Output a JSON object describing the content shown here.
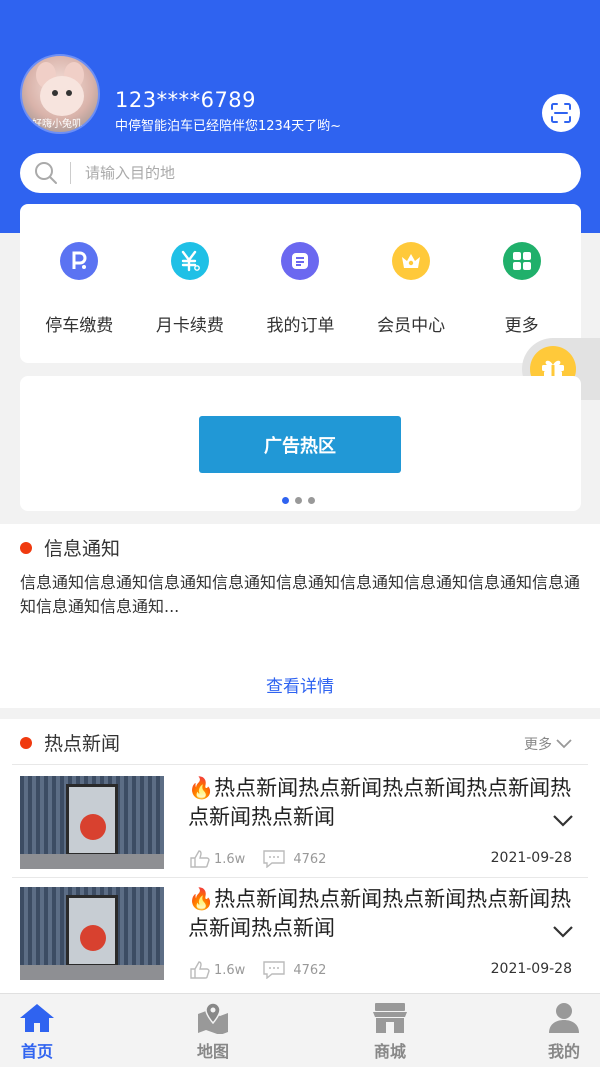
{
  "header": {
    "avatar_caption": "好嗨小兔叽",
    "phone": "123****6789",
    "subtitle": "中停智能泊车已经陪伴您1234天了哟~"
  },
  "search": {
    "placeholder": "请输入目的地"
  },
  "menu": [
    {
      "label": "停车缴费",
      "icon": "parking-icon",
      "color": "#5b73f2"
    },
    {
      "label": "月卡续费",
      "icon": "yuan-card-icon",
      "color": "#1fc0e6"
    },
    {
      "label": "我的订单",
      "icon": "order-icon",
      "color": "#6b68f0"
    },
    {
      "label": "会员中心",
      "icon": "crown-icon",
      "color": "#ffc93a"
    },
    {
      "label": "更多",
      "icon": "grid-icon",
      "color": "#20b06b"
    }
  ],
  "ad": {
    "label": "广告热区",
    "dots": 3,
    "active_dot": 1
  },
  "notice": {
    "title": "信息通知",
    "text": "信息通知信息通知信息通知信息通知信息通知信息通知信息通知信息通知信息通知信息通知信息通知...",
    "more": "查看详情"
  },
  "news": {
    "title": "热点新闻",
    "more": "更多",
    "items": [
      {
        "title": "热点新闻热点新闻热点新闻热点新闻热点新闻热点新闻",
        "likes": "1.6w",
        "comments": "4762",
        "date": "2021-09-28"
      },
      {
        "title": "热点新闻热点新闻热点新闻热点新闻热点新闻热点新闻",
        "likes": "1.6w",
        "comments": "4762",
        "date": "2021-09-28"
      }
    ]
  },
  "tabbar": [
    {
      "label": "首页",
      "icon": "home-icon",
      "active": true
    },
    {
      "label": "地图",
      "icon": "map-pin-icon",
      "active": false
    },
    {
      "label": "商城",
      "icon": "store-icon",
      "active": false
    },
    {
      "label": "我的",
      "icon": "user-icon",
      "active": false
    }
  ],
  "colors": {
    "primary": "#2f63f0",
    "ad_button": "#2198d6",
    "accent_red": "#f03a0f"
  }
}
